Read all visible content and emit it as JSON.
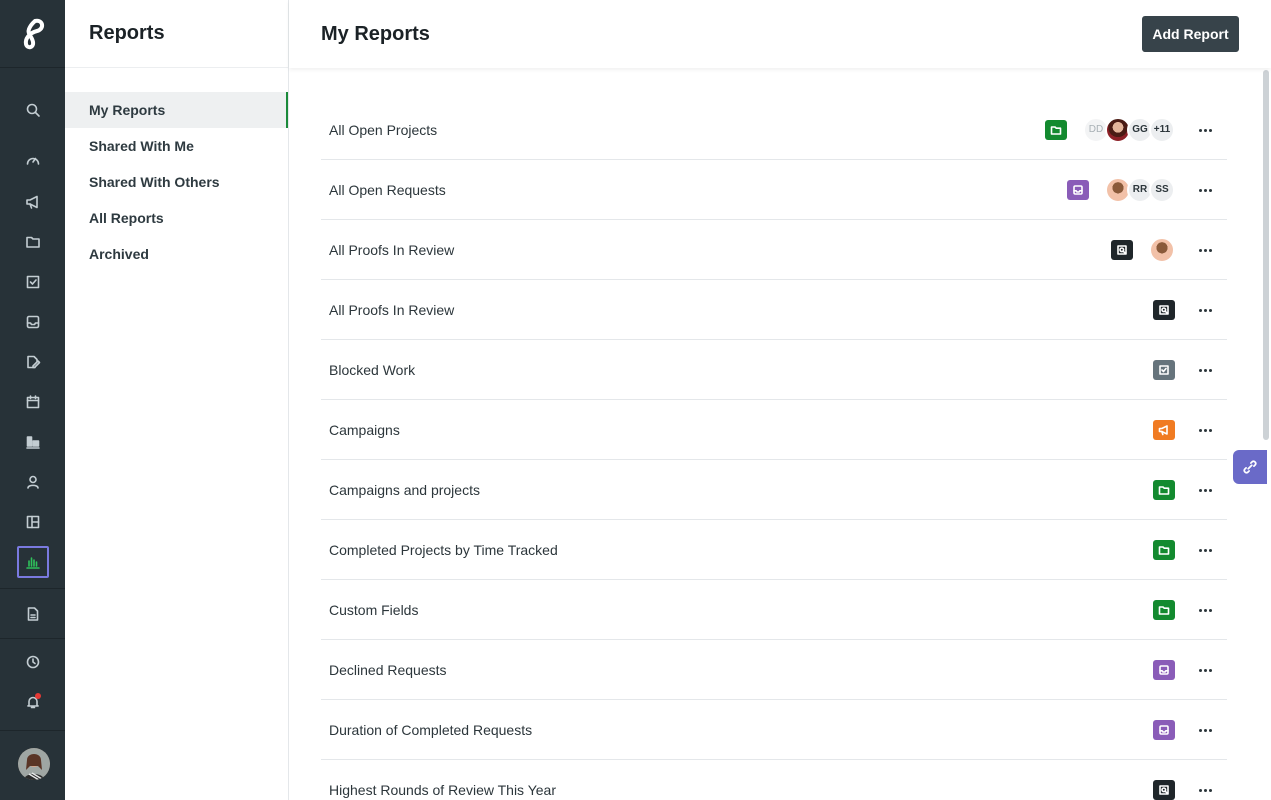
{
  "app": {
    "brand_icon": "brand-logo-icon"
  },
  "rail": {
    "items": [
      {
        "icon": "search-icon"
      },
      {
        "icon": "dashboard-gauge-icon"
      },
      {
        "icon": "megaphone-icon"
      },
      {
        "icon": "folder-icon"
      },
      {
        "icon": "task-check-icon"
      },
      {
        "icon": "inbox-icon"
      },
      {
        "icon": "file-edit-icon"
      },
      {
        "icon": "calendar-icon"
      },
      {
        "icon": "board-icon"
      },
      {
        "icon": "user-icon"
      },
      {
        "icon": "layout-icon"
      },
      {
        "icon": "reports-chart-icon",
        "active": true
      },
      {
        "icon": "document-icon"
      },
      {
        "icon": "clock-icon"
      },
      {
        "icon": "bell-icon",
        "notification": true
      }
    ],
    "active_color": "#2fc25b"
  },
  "subnav": {
    "title": "Reports",
    "items": [
      {
        "label": "My Reports",
        "active": true
      },
      {
        "label": "Shared With Me"
      },
      {
        "label": "Shared With Others"
      },
      {
        "label": "All Reports"
      },
      {
        "label": "Archived"
      }
    ]
  },
  "main": {
    "title": "My Reports",
    "add_button": "Add Report",
    "reports": [
      {
        "name": "All Open Projects",
        "type": "project",
        "avatars": [
          "DD",
          "photo",
          "GG",
          "+11"
        ]
      },
      {
        "name": "All Open Requests",
        "type": "request",
        "avatars": [
          "photo",
          "RR",
          "SS"
        ]
      },
      {
        "name": "All Proofs In Review",
        "type": "proof",
        "avatars": [
          "photo"
        ]
      },
      {
        "name": "All Proofs In Review",
        "type": "proof",
        "avatars": []
      },
      {
        "name": "Blocked Work",
        "type": "task",
        "avatars": []
      },
      {
        "name": "Campaigns",
        "type": "campaign",
        "avatars": []
      },
      {
        "name": "Campaigns and projects",
        "type": "project",
        "avatars": []
      },
      {
        "name": "Completed Projects by Time Tracked",
        "type": "project",
        "avatars": []
      },
      {
        "name": "Custom Fields",
        "type": "project",
        "avatars": []
      },
      {
        "name": "Declined Requests",
        "type": "request",
        "avatars": []
      },
      {
        "name": "Duration of Completed Requests",
        "type": "request",
        "avatars": []
      },
      {
        "name": "Highest Rounds of Review This Year",
        "type": "proof",
        "avatars": []
      }
    ],
    "type_colors": {
      "project": "#138a2f",
      "request": "#8a5cb8",
      "proof": "#1f262a",
      "task": "#66747c",
      "campaign": "#f07b22"
    }
  }
}
